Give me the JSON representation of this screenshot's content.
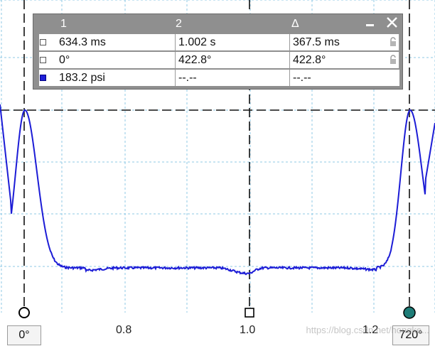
{
  "colors": {
    "trace": "#1c1cd6",
    "grid": "#8fc9e6",
    "cursor": "#111111",
    "marker_fill": "#1e7c77"
  },
  "table": {
    "headers": [
      "1",
      "2",
      "Δ"
    ],
    "minimize_icon": "minimize-icon",
    "close_icon": "close-icon",
    "rows": [
      {
        "c1": "634.3 ms",
        "c2": "1.002 s",
        "c3": "367.5 ms",
        "swatch": "white",
        "locked": true
      },
      {
        "c1": "0°",
        "c2": "422.8°",
        "c3": "422.8°",
        "swatch": "white",
        "locked": true
      },
      {
        "c1": "183.2 psi",
        "c2": "--.--",
        "c3": "--.--",
        "swatch": "blue",
        "locked": false
      }
    ]
  },
  "axis": {
    "ticks": [
      "0.8",
      "1.0",
      "1.2"
    ]
  },
  "markers": {
    "left": "0°",
    "right": "720°"
  },
  "watermark": "https://blog.csdn.net/hongke..."
}
